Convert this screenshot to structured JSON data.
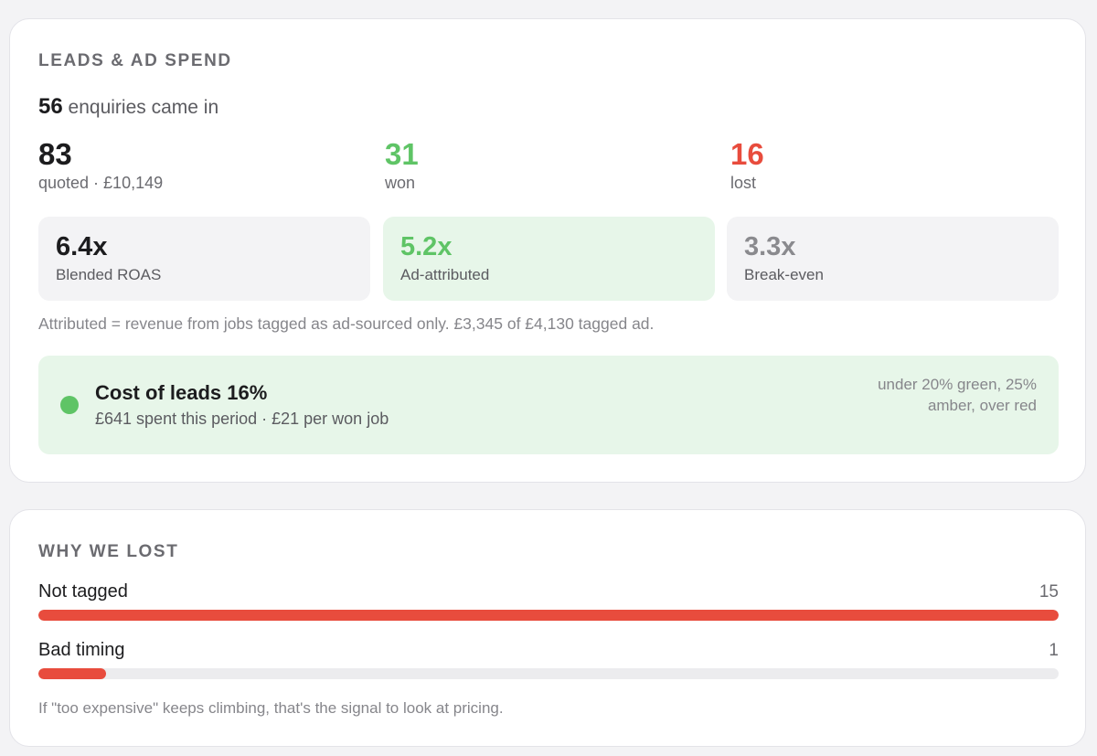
{
  "colors": {
    "green": "#5fc466",
    "red": "#e84c3d",
    "gray_value": "#8a8a8e",
    "bar_fill": "#e84c3d"
  },
  "leads": {
    "title": "LEADS & AD SPEND",
    "enquiries_count": "56",
    "enquiries_text": "enquiries came in",
    "stats": {
      "quoted": {
        "value": "83",
        "label": "quoted · £10,149"
      },
      "won": {
        "value": "31",
        "label": "won"
      },
      "lost": {
        "value": "16",
        "label": "lost"
      }
    },
    "tiles": {
      "blended": {
        "value": "6.4x",
        "label": "Blended ROAS"
      },
      "attributed": {
        "value": "5.2x",
        "label": "Ad-attributed"
      },
      "breakeven": {
        "value": "3.3x",
        "label": "Break-even"
      }
    },
    "note": "Attributed = revenue from jobs tagged as ad-sourced only. £3,345 of £4,130 tagged ad.",
    "cost": {
      "title": "Cost of leads 16%",
      "subtitle": "£641 spent this period · £21 per won job",
      "legend": "under 20% green, 25% amber, over red"
    }
  },
  "lost_reasons": {
    "title": "WHY WE LOST",
    "max": 15,
    "items": [
      {
        "label": "Not tagged",
        "count": "15",
        "value": 15
      },
      {
        "label": "Bad timing",
        "count": "1",
        "value": 1
      }
    ],
    "note": "If \"too expensive\" keeps climbing, that's the signal to look at pricing."
  }
}
